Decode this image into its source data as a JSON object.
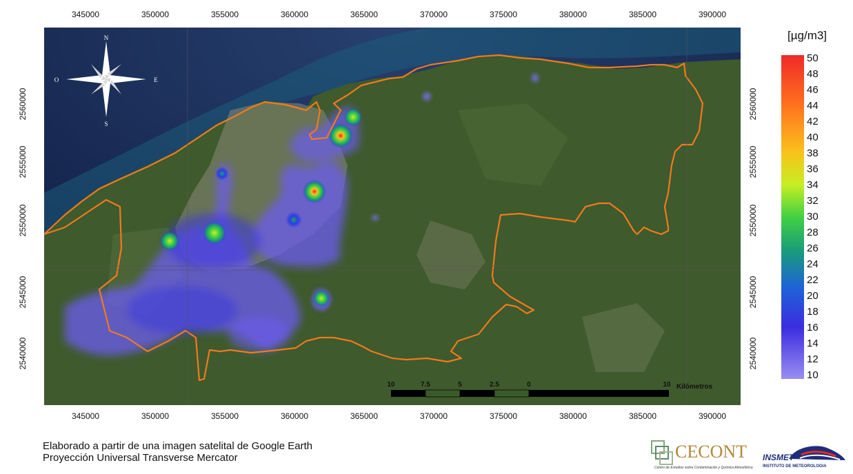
{
  "x_ticks": [
    "345000",
    "350000",
    "355000",
    "360000",
    "365000",
    "370000",
    "375000",
    "380000",
    "385000",
    "390000"
  ],
  "y_ticks": [
    "2560000",
    "2555000",
    "2550000",
    "2545000",
    "2540000"
  ],
  "compass": {
    "n": "N",
    "s": "S",
    "e": "E",
    "w": "O"
  },
  "legend": {
    "unit": "[µg/m3]",
    "values": [
      "50",
      "48",
      "46",
      "44",
      "42",
      "40",
      "38",
      "36",
      "34",
      "32",
      "30",
      "28",
      "26",
      "24",
      "22",
      "20",
      "18",
      "16",
      "14",
      "12",
      "10"
    ]
  },
  "scale_bar": {
    "labels": [
      "10",
      "7.5",
      "5",
      "2.5",
      "0",
      "10"
    ],
    "unit": "Kilómetros"
  },
  "footer": {
    "line1": "Elaborado a partir de una imagen satelital de Google Earth",
    "line2": "Proyección Universal Transverse Mercator"
  },
  "logos": {
    "cecont_title": "CECONT",
    "cecont_subtitle": "Centro de Estudios sobre Contaminación y Química Atmosférica",
    "insmet_title": "INSMET",
    "insmet_subtitle": "INSTITUTO DE METEOROLOGIA"
  },
  "colors": {
    "sea": "#13234f",
    "land": "#3f5a2c",
    "boundary": "#f07a1e",
    "low": "#8a7ff0",
    "mid": "#2c3de6",
    "high": "#ef2a1c"
  }
}
